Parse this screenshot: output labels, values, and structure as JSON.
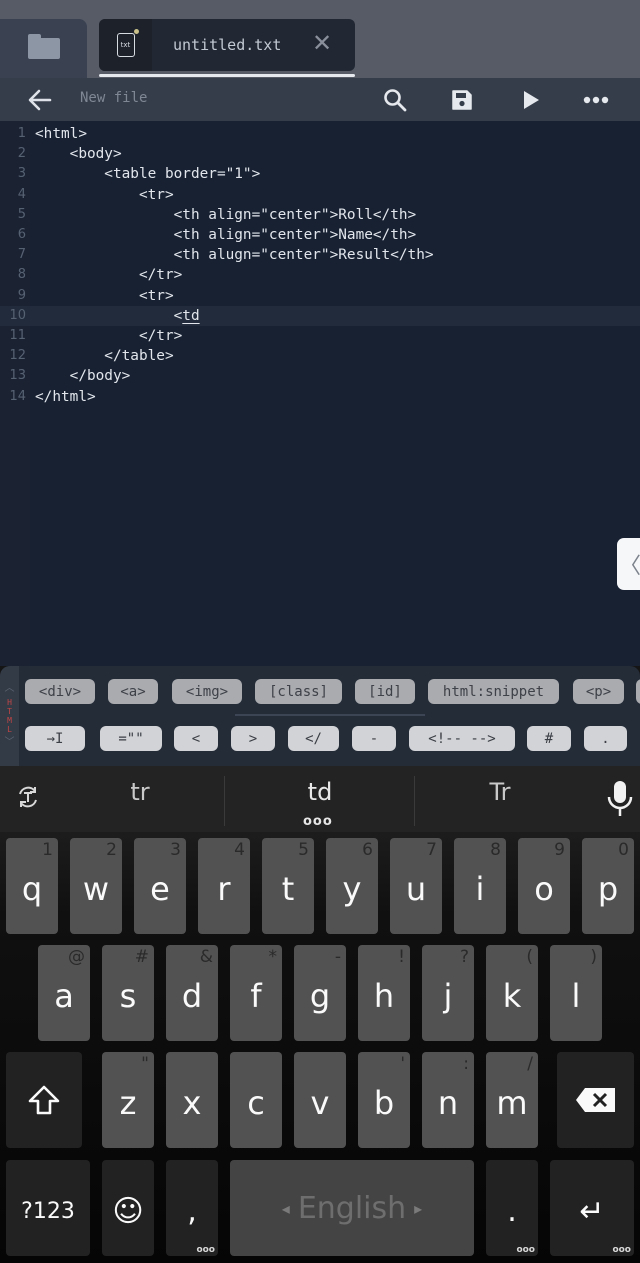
{
  "tabstrip": {
    "folder_icon": "folder-icon",
    "tab": {
      "icon_label": "txt",
      "title": "untitled.txt",
      "modified": true,
      "close_symbol": "✕"
    }
  },
  "toolbar": {
    "back_icon": "arrow-left-icon",
    "title": "New file",
    "actions": [
      "search-icon",
      "save-icon",
      "run-icon",
      "more-icon"
    ]
  },
  "editor": {
    "active_line": 10,
    "lines": [
      {
        "num": "1",
        "code": "<html>"
      },
      {
        "num": "2",
        "code": "    <body>"
      },
      {
        "num": "3",
        "code": "        <table border=\"1\">"
      },
      {
        "num": "4",
        "code": "            <tr>"
      },
      {
        "num": "5",
        "code": "                <th align=\"center\">Roll</th>"
      },
      {
        "num": "6",
        "code": "                <th align=\"center\">Name</th>"
      },
      {
        "num": "7",
        "code": "                <th alugn=\"center\">Result</th>"
      },
      {
        "num": "8",
        "code": "            </tr>"
      },
      {
        "num": "9",
        "code": "            <tr>"
      },
      {
        "num": "10",
        "code_prefix": "                <",
        "code_word": "td"
      },
      {
        "num": "11",
        "code": "            </tr>"
      },
      {
        "num": "12",
        "code": "        </table>"
      },
      {
        "num": "13",
        "code": "    </body>"
      },
      {
        "num": "14",
        "code": "</html>"
      }
    ],
    "side_handle": "〈"
  },
  "snippets": {
    "language": "HTML",
    "tags": [
      "<div>",
      "<a>",
      "<img>",
      "[class]",
      "[id]",
      "html:snippet",
      "<p>"
    ],
    "symbols": [
      "→I",
      "=\"\"",
      "<",
      ">",
      "</",
      "-",
      "<!-- -->",
      "#",
      "."
    ]
  },
  "keyboard": {
    "suggestions": [
      "tr",
      "td",
      "Tr"
    ],
    "suggestion_more": "ooo",
    "row1": [
      {
        "key": "q",
        "hint": "1"
      },
      {
        "key": "w",
        "hint": "2"
      },
      {
        "key": "e",
        "hint": "3"
      },
      {
        "key": "r",
        "hint": "4"
      },
      {
        "key": "t",
        "hint": "5"
      },
      {
        "key": "y",
        "hint": "6"
      },
      {
        "key": "u",
        "hint": "7"
      },
      {
        "key": "i",
        "hint": "8"
      },
      {
        "key": "o",
        "hint": "9"
      },
      {
        "key": "p",
        "hint": "0"
      }
    ],
    "row2": [
      {
        "key": "a",
        "hint": "@"
      },
      {
        "key": "s",
        "hint": "#"
      },
      {
        "key": "d",
        "hint": "&"
      },
      {
        "key": "f",
        "hint": "*"
      },
      {
        "key": "g",
        "hint": "-"
      },
      {
        "key": "h",
        "hint": "!"
      },
      {
        "key": "j",
        "hint": "?"
      },
      {
        "key": "k",
        "hint": "("
      },
      {
        "key": "l",
        "hint": ")"
      }
    ],
    "row3": [
      {
        "key": "z",
        "hint": "\""
      },
      {
        "key": "x",
        "hint": ""
      },
      {
        "key": "c",
        "hint": ""
      },
      {
        "key": "v",
        "hint": ""
      },
      {
        "key": "b",
        "hint": "'"
      },
      {
        "key": "n",
        "hint": ":"
      },
      {
        "key": "m",
        "hint": "/"
      }
    ],
    "symbols_key": "?123",
    "emoji_key": "☺",
    "comma_key": ",",
    "space_label": "English",
    "period_key": ".",
    "enter_key": "↵",
    "more_dots": "ooo"
  }
}
